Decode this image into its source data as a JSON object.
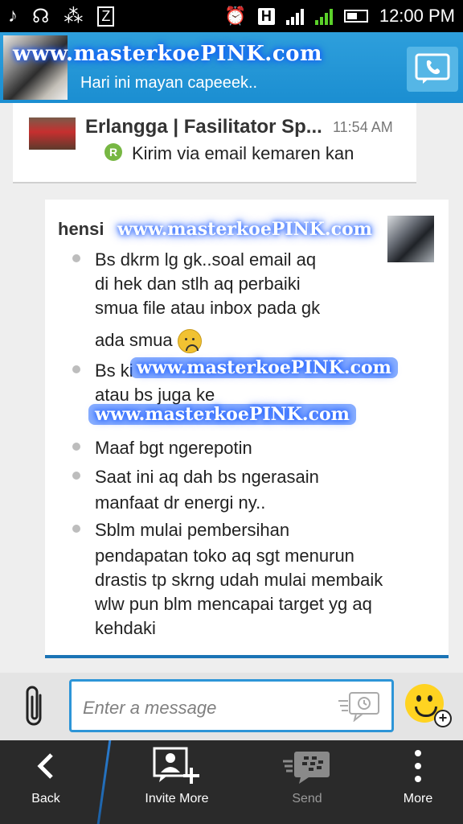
{
  "status_bar": {
    "time": "12:00 PM",
    "network": "H"
  },
  "header": {
    "watermark": "www.masterkoePINK.com",
    "status_message": "Hari ini mayan capeeek.."
  },
  "chat_card": {
    "name": "Erlangga | Fasilitator Sp...",
    "time": "11:54 AM",
    "badge": "R",
    "preview": "Kirim via email kemaren kan"
  },
  "message": {
    "sender": "hensi",
    "watermark": "www.masterkoePINK.com",
    "items": [
      {
        "lines": [
          "Bs dkrm lg gk..soal email aq",
          "di hek dan stlh aq perbaiki",
          "smua file atau inbox pada gk"
        ],
        "last": "ada smua"
      },
      {
        "lines": [
          "Bs ki",
          "atau bs juga ke"
        ]
      },
      {
        "lines": [
          "Maaf bgt ngerepotin"
        ]
      },
      {
        "lines": [
          "Saat ini aq dah bs ngerasain",
          "manfaat dr energi ny.."
        ]
      },
      {
        "lines": [
          "Sblm mulai pembersihan",
          "pendapatan toko aq sgt menurun",
          "drastis tp skrng udah mulai membaik",
          "wlw pun blm mencapai target yg aq",
          "kehdaki"
        ]
      }
    ]
  },
  "composer": {
    "placeholder": "Enter a message"
  },
  "bottom_bar": {
    "back": "Back",
    "invite": "Invite More",
    "send": "Send",
    "more": "More"
  },
  "colors": {
    "header_blue": "#1b8ed1",
    "accent_blue": "#2d95d7",
    "badge_green": "#77b743"
  }
}
